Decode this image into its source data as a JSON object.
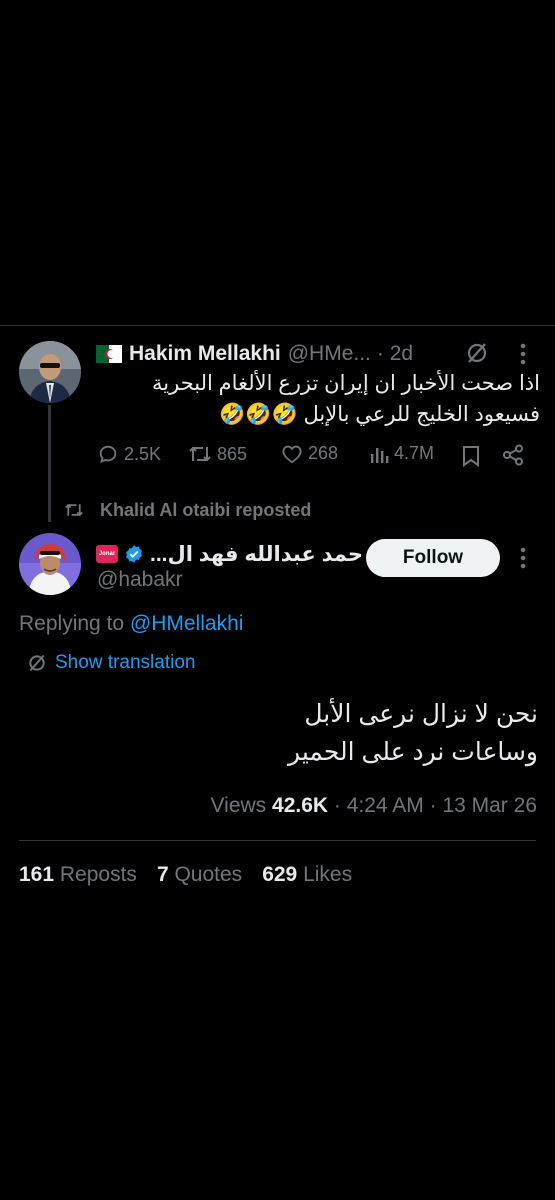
{
  "original_tweet": {
    "display_name": "Hakim Mellakhi",
    "handle": "@HMe...",
    "time": "· 2d",
    "text_line1": "اذا صحت الأخبار ان إيران تزرع الألغام البحرية",
    "text_line2": "فسيعود الخليج للرعي بالإبل 🤣🤣🤣",
    "replies": "2.5K",
    "reposts": "865",
    "likes": "268",
    "views": "4.7M"
  },
  "repost_banner": "Khalid Al otaibi reposted",
  "main_tweet": {
    "display_name": "حمد عبدالله فهد ال...",
    "badge_text": "Jonar",
    "handle": "@habakr",
    "follow_label": "Follow",
    "replying_prefix": "Replying to",
    "replying_to": "@HMellakhi",
    "show_translation": "Show translation",
    "text_line1": "نحن لا نزال نرعى الأبل",
    "text_line2": "وساعات نرد على الحمير",
    "views_label": "Views",
    "views_count": "42.6K",
    "time": "· 4:24 AM · 13 Mar 26"
  },
  "stats": {
    "reposts_count": "161",
    "reposts_label": "Reposts",
    "quotes_count": "7",
    "quotes_label": "Quotes",
    "likes_count": "629",
    "likes_label": "Likes"
  },
  "icons": {
    "reply": "reply-icon",
    "repost": "repost-icon",
    "like": "heart-icon",
    "views": "views-icon",
    "bookmark": "bookmark-icon",
    "share": "share-icon",
    "grok": "grok-icon",
    "more": "more-vertical-icon",
    "verified": "verified-badge-icon",
    "translate": "translate-icon"
  },
  "colors": {
    "background": "#000000",
    "text": "#e7e9ea",
    "muted": "#71767b",
    "link": "#1d9bf0",
    "verified": "#1d9bf0",
    "follow_bg": "#eff3f4"
  }
}
